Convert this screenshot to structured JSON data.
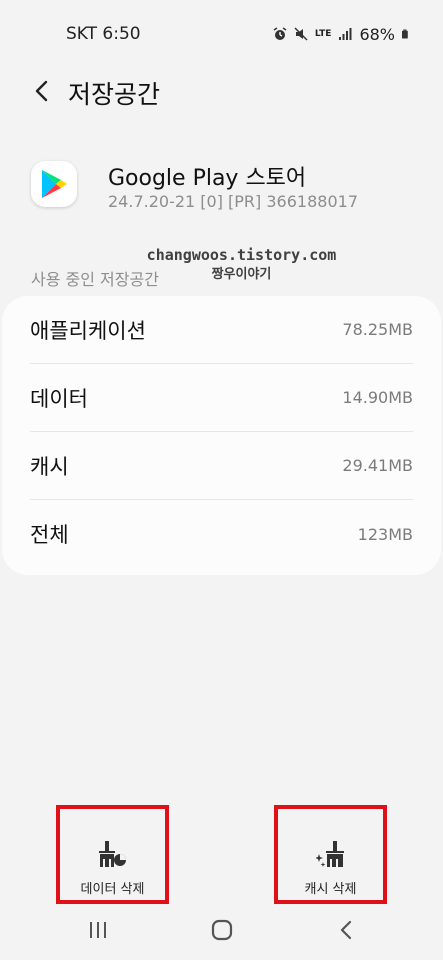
{
  "status_bar": {
    "carrier_time": "SKT 6:50",
    "network": "LTE",
    "battery": "68%",
    "icons": [
      "alarm-icon",
      "mute-icon",
      "lte-icon",
      "signal-icon",
      "battery-icon"
    ]
  },
  "header": {
    "back_icon": "chevron-left-icon",
    "title": "저장공간"
  },
  "app": {
    "icon": "google-play-logo",
    "name": "Google Play 스토어",
    "version": "24.7.20-21 [0] [PR] 366188017"
  },
  "watermark": {
    "line1": "changwoos.tistory.com",
    "line2": "짱우이야기"
  },
  "storage": {
    "section_label": "사용 중인 저장공간",
    "rows": [
      {
        "label": "애플리케이션",
        "value": "78.25MB"
      },
      {
        "label": "데이터",
        "value": "14.90MB"
      },
      {
        "label": "캐시",
        "value": "29.41MB"
      },
      {
        "label": "전체",
        "value": "123MB"
      }
    ]
  },
  "actions": {
    "clear_data": {
      "label": "데이터 삭제",
      "icon": "clear-data-icon"
    },
    "clear_cache": {
      "label": "캐시 삭제",
      "icon": "clear-cache-icon"
    },
    "highlight_color": "#e0101a"
  },
  "nav": {
    "icons": [
      "recent-apps-icon",
      "home-icon",
      "back-icon"
    ]
  }
}
